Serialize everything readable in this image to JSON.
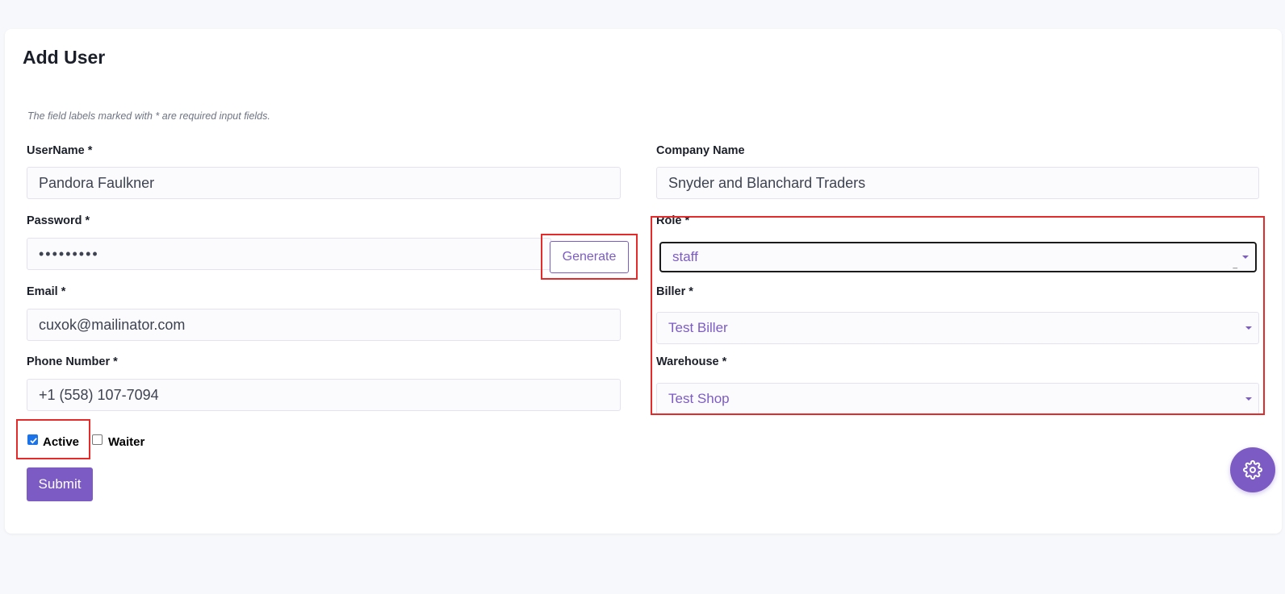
{
  "page": {
    "title": "Add User",
    "required_note": "The field labels marked with * are required input fields."
  },
  "form": {
    "username": {
      "label": "UserName *",
      "value": "Pandora Faulkner"
    },
    "company": {
      "label": "Company Name",
      "value": "Snyder and Blanchard Traders"
    },
    "password": {
      "label": "Password *",
      "value": "•••••••••",
      "generate_label": "Generate"
    },
    "role": {
      "label": "Role *",
      "value": "staff"
    },
    "email": {
      "label": "Email *",
      "value": "cuxok@mailinator.com"
    },
    "biller": {
      "label": "Biller *",
      "value": "Test Biller"
    },
    "phone": {
      "label": "Phone Number *",
      "value": "+1 (558) 107-7094"
    },
    "warehouse": {
      "label": "Warehouse *",
      "value": "Test Shop"
    },
    "active": {
      "label": "Active",
      "checked": true
    },
    "waiter": {
      "label": "Waiter",
      "checked": false
    },
    "submit_label": "Submit"
  },
  "icons": {
    "settings": "gear-icon",
    "dropdown": "chevron-down-icon",
    "checkmark": "checkmark-icon"
  },
  "colors": {
    "accent": "#7c5cc4",
    "highlight": "#e32b2b",
    "checkbox": "#1a73e8"
  }
}
